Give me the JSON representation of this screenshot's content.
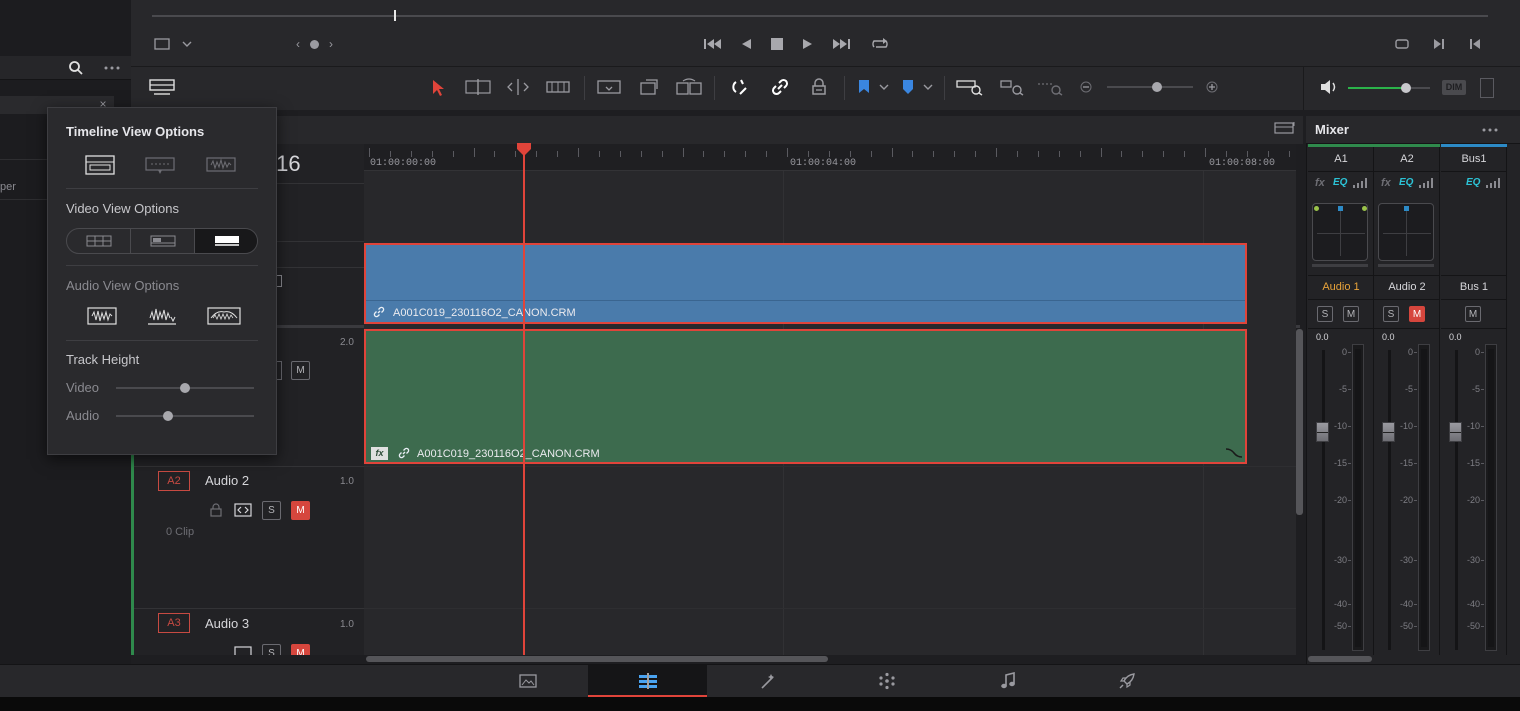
{
  "left_panel": {
    "partial_text": "per"
  },
  "transport": {
    "buttons": [
      "go-to-start",
      "reverse",
      "stop",
      "play",
      "go-to-end",
      "loop"
    ]
  },
  "timecode": {
    "partial": ":16"
  },
  "ruler": {
    "labels": [
      "01:00:00:00",
      "01:00:04:00",
      "01:00:08:00"
    ]
  },
  "view_options": {
    "title": "Timeline View Options",
    "video_section": "Video View Options",
    "audio_section": "Audio View Options",
    "track_height": "Track Height",
    "video_label": "Video",
    "audio_label": "Audio",
    "video_slider": 0.5,
    "audio_slider": 0.38
  },
  "tracks": {
    "a1_level": "2.0",
    "a2": {
      "id": "A2",
      "name": "Audio 2",
      "level": "1.0",
      "clips": "0 Clip",
      "s": "S",
      "m": "M"
    },
    "a3": {
      "id": "A3",
      "name": "Audio 3",
      "level": "1.0",
      "s": "S",
      "m": "M"
    },
    "a1_m": "M"
  },
  "clips": {
    "video": {
      "name": "A001C019_230116O2_CANON.CRM"
    },
    "audio": {
      "name": "A001C019_230116O2_CANON.CRM",
      "fx": "fx"
    }
  },
  "mixer": {
    "title": "Mixer",
    "channels": [
      {
        "id": "A1",
        "name": "Audio 1",
        "value": "0.0",
        "fx": "fx",
        "eq": "EQ",
        "s": "S",
        "m": "M",
        "m_on": false,
        "active": true
      },
      {
        "id": "A2",
        "name": "Audio 2",
        "value": "0.0",
        "fx": "fx",
        "eq": "EQ",
        "s": "S",
        "m": "M",
        "m_on": true,
        "active": false
      },
      {
        "id": "Bus1",
        "name": "Bus 1",
        "value": "0.0",
        "eq": "EQ",
        "m": "M",
        "active": false
      }
    ],
    "scale": [
      "0",
      "-5",
      "-10",
      "-15",
      "-20",
      "-30",
      "-40",
      "-50"
    ],
    "dim_label": "DIM",
    "volume_level": 0.8
  },
  "colors": {
    "video_clip": "#4a7bab",
    "audio_clip": "#3d6b4e",
    "playhead": "#e0443a",
    "accent_cyan": "#2cc3d6",
    "mute_red": "#d6463d",
    "active_orange": "#e8a33a"
  },
  "page_tabs": [
    "media",
    "edit",
    "fusion",
    "color",
    "fairlight",
    "deliver"
  ]
}
